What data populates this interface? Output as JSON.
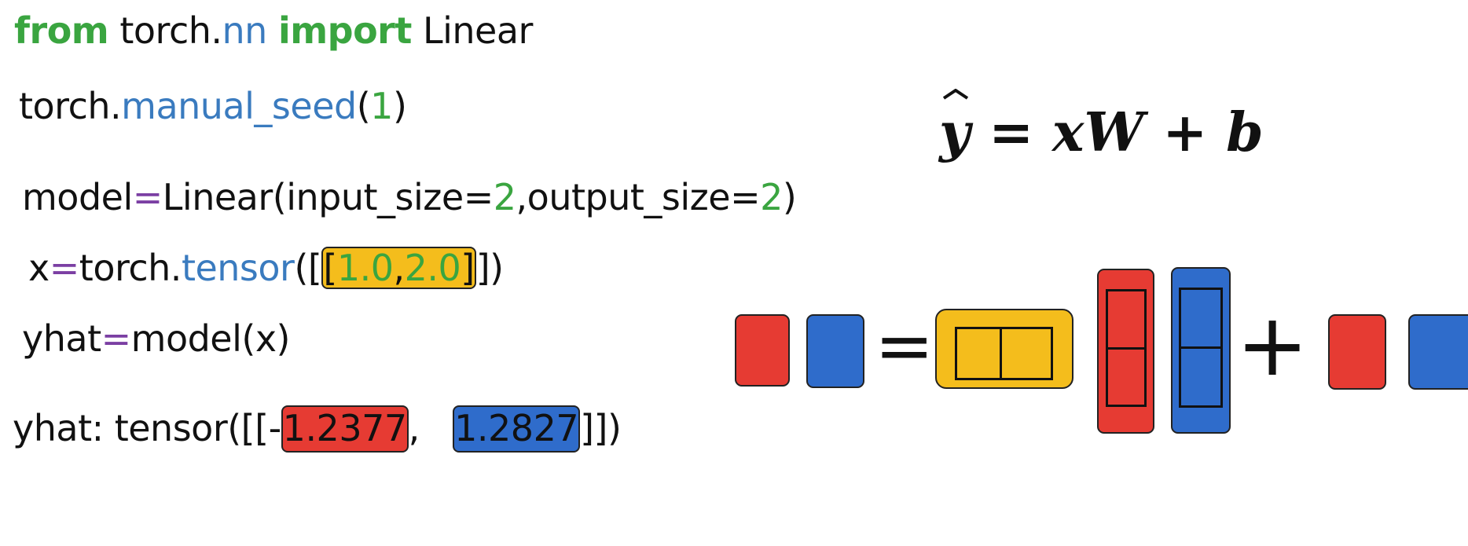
{
  "code": {
    "import_line": {
      "from": "from",
      "torch": "torch.",
      "nn": "nn",
      "import": "import",
      "linear": "Linear"
    },
    "seed_line": {
      "torch": "torch.",
      "fn": "manual_seed",
      "open": "(",
      "arg": "1",
      "close": ")"
    },
    "model_line": {
      "model": "model",
      "eq": "=",
      "call": "Linear(input_size=",
      "in": "2",
      "mid": ",output_size=",
      "out": "2",
      "close": ")"
    },
    "x_line": {
      "x": "x",
      "eq": "=",
      "torch": "torch.",
      "fn": "tensor",
      "open": "([",
      "bracket": "[",
      "v1": "1.0",
      "comma": ",",
      "v2": "2.0",
      "bracket_close": "]",
      "close": "])"
    },
    "yhat_line": {
      "yhat": "yhat",
      "eq": "=",
      "call": "model(x)"
    },
    "output_line": {
      "label": "yhat: tensor([[-",
      "v1": "1.2377",
      "sep": ",   ",
      "v2": "1.2827",
      "close": "]])"
    }
  },
  "equation": {
    "y": "y",
    "rest": " = xW + b"
  },
  "diagram": {
    "equals": "=",
    "plus": "+",
    "colors": {
      "red": "#e63b33",
      "blue": "#2f6ccb",
      "yellow": "#f4bd1c",
      "outline": "#222222"
    }
  }
}
